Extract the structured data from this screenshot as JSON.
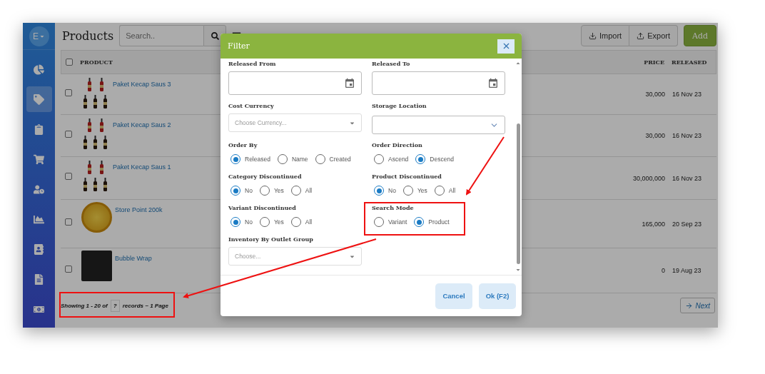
{
  "sidebar": {
    "avatar": "E",
    "items": [
      {
        "selected": false
      },
      {
        "selected": true
      },
      {
        "selected": false
      },
      {
        "selected": false
      },
      {
        "selected": false
      },
      {
        "selected": false
      },
      {
        "selected": false
      },
      {
        "selected": false
      },
      {
        "selected": false
      }
    ]
  },
  "header": {
    "title": "Products",
    "search": {
      "placeholder": "Search.."
    },
    "buttons": [
      {
        "label": "Import",
        "kind": "import"
      },
      {
        "label": "Export",
        "kind": "export"
      },
      {
        "label": "Add",
        "kind": "primary"
      }
    ]
  },
  "table": {
    "all_checked": false,
    "columns": [
      "PRODUCT",
      "PRICE",
      "RELEASED"
    ],
    "rows": [
      {
        "name": "Paket Kecap Saus 3",
        "kind": "bottles",
        "price": "30,000",
        "released": "16 Nov 23",
        "checked": false
      },
      {
        "name": "Paket Kecap Saus 2",
        "kind": "bottles",
        "price": "30,000",
        "released": "16 Nov 23",
        "checked": false
      },
      {
        "name": "Paket Kecap Saus 1",
        "kind": "bottles",
        "price": "30,000,000",
        "released": "16 Nov 23",
        "checked": false
      },
      {
        "name": "Store Point 200k",
        "kind": "coin",
        "price": "165,000",
        "released": "20 Sep 23",
        "checked": false
      },
      {
        "name": "Bubble Wrap",
        "kind": "photo",
        "price": "0",
        "released": "19 Aug 23",
        "checked": false
      }
    ]
  },
  "footer": {
    "showing": "Showing 1 - 20 of",
    "count": "?",
    "records": "records ~ 1 Page",
    "next": "Next"
  },
  "modal": {
    "title": "Filter",
    "fields": [
      {
        "kind": "date",
        "label": "Released From"
      },
      {
        "kind": "date",
        "label": "Released To"
      },
      {
        "kind": "select",
        "label": "Cost Currency",
        "placeholder": "Choose Currency..."
      },
      {
        "kind": "combo",
        "label": "Storage Location"
      },
      {
        "kind": "radio",
        "label": "Order By",
        "options": [
          {
            "label": "Released",
            "selected": true
          },
          {
            "label": "Name",
            "selected": false
          },
          {
            "label": "Created",
            "selected": false
          }
        ]
      },
      {
        "kind": "radio",
        "label": "Order Direction",
        "options": [
          {
            "label": "Ascend",
            "selected": false
          },
          {
            "label": "Descend",
            "selected": true
          }
        ]
      },
      {
        "kind": "radio",
        "label": "Category Discontinued",
        "options": [
          {
            "label": "No",
            "selected": true
          },
          {
            "label": "Yes",
            "selected": false
          },
          {
            "label": "All",
            "selected": false
          }
        ]
      },
      {
        "kind": "radio",
        "label": "Product Discontinued",
        "options": [
          {
            "label": "No",
            "selected": true
          },
          {
            "label": "Yes",
            "selected": false
          },
          {
            "label": "All",
            "selected": false
          }
        ]
      },
      {
        "kind": "radio",
        "label": "Variant Discontinued",
        "options": [
          {
            "label": "No",
            "selected": true
          },
          {
            "label": "Yes",
            "selected": false
          },
          {
            "label": "All",
            "selected": false
          }
        ]
      },
      {
        "kind": "radio",
        "label": "Search Mode",
        "options": [
          {
            "label": "Variant",
            "selected": false
          },
          {
            "label": "Product",
            "selected": true
          }
        ]
      },
      {
        "kind": "select",
        "label": "Inventory By Outlet Group",
        "placeholder": "Choose..."
      }
    ],
    "buttons": [
      "Cancel",
      "Ok (F2)"
    ]
  }
}
